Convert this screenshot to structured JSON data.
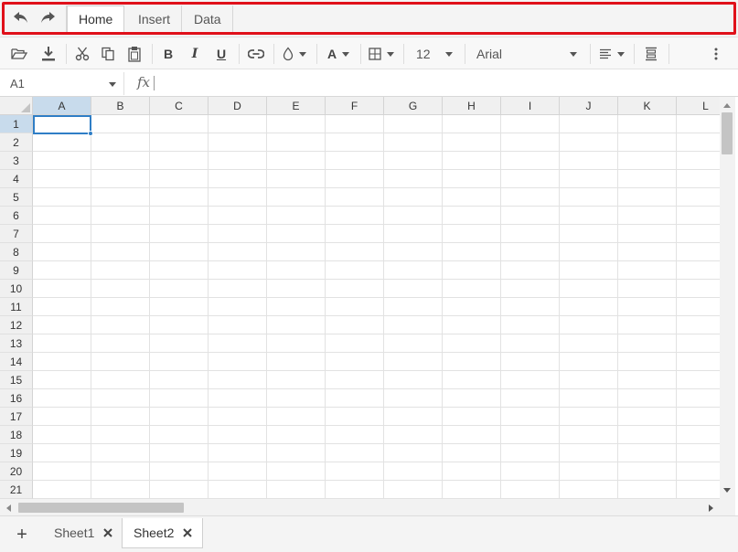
{
  "menu": {
    "undo_icon": "undo-icon",
    "redo_icon": "redo-icon",
    "tabs": [
      {
        "label": "Home",
        "active": true
      },
      {
        "label": "Insert",
        "active": false
      },
      {
        "label": "Data",
        "active": false
      }
    ]
  },
  "toolbar": {
    "bold_label": "B",
    "italic_label": "I",
    "underline_label": "U",
    "text_color_label": "A",
    "font_size": "12",
    "font_family": "Arial"
  },
  "formula_bar": {
    "name_box": "A1",
    "fx_label": "fx",
    "formula_value": ""
  },
  "grid": {
    "columns": [
      "A",
      "B",
      "C",
      "D",
      "E",
      "F",
      "G",
      "H",
      "I",
      "J",
      "K",
      "L"
    ],
    "rows": [
      "1",
      "2",
      "3",
      "4",
      "5",
      "6",
      "7",
      "8",
      "9",
      "10",
      "11",
      "12",
      "13",
      "14",
      "15",
      "16",
      "17",
      "18",
      "19",
      "20",
      "21"
    ],
    "selected_column": "A",
    "selected_row": "1"
  },
  "sheets": {
    "add_label": "+",
    "tabs": [
      {
        "label": "Sheet1",
        "active": false
      },
      {
        "label": "Sheet2",
        "active": true
      }
    ]
  },
  "colors": {
    "highlight": "#e0101a",
    "selection": "#2f7ec6",
    "header_selected": "#c8dbec"
  }
}
